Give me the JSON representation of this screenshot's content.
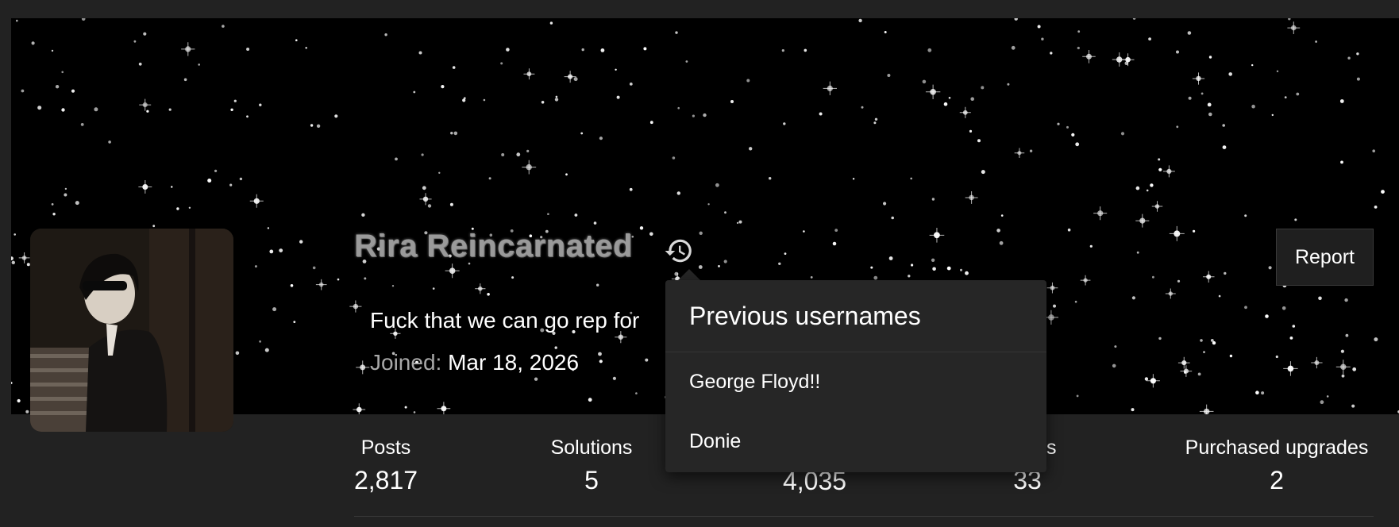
{
  "profile": {
    "username": "Rira Reincarnated",
    "status_text": "Fuck that we can go rep for",
    "joined_label": "Joined:",
    "joined_date": "Mar 18, 2026",
    "report_label": "Report",
    "history_icon": "history-icon"
  },
  "stats": [
    {
      "label": "Posts",
      "value": "2,817"
    },
    {
      "label": "Solutions",
      "value": "5"
    },
    {
      "label": "",
      "value": "4,035"
    },
    {
      "label": "s",
      "value": "33"
    },
    {
      "label": "Purchased upgrades",
      "value": "2"
    }
  ],
  "popover": {
    "title": "Previous usernames",
    "items": [
      "George Floyd!!",
      "Donie"
    ]
  },
  "colors": {
    "page_bg": "#222222",
    "banner_bg": "#000000",
    "popover_bg": "#262626",
    "username": "#9a9a9a"
  }
}
